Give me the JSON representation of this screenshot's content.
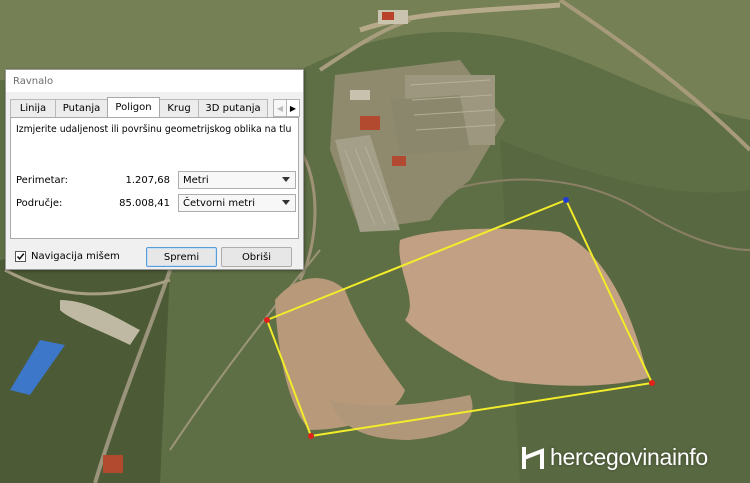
{
  "dialog": {
    "title": "Ravnalo",
    "tabs": [
      {
        "label": "Linija"
      },
      {
        "label": "Putanja"
      },
      {
        "label": "Poligon",
        "active": true
      },
      {
        "label": "Krug"
      },
      {
        "label": "3D putanja"
      }
    ],
    "description": "Izmjerite udaljenost ili površinu geometrijskog oblika na tlu",
    "perimeter": {
      "label": "Perimetar:",
      "value": "1.207,68",
      "unit": "Metri"
    },
    "area": {
      "label": "Područje:",
      "value": "85.008,41",
      "unit": "Četvorni metri"
    },
    "mouse_navigation": {
      "label": "Navigacija mišem",
      "checked": true
    },
    "save_button": "Spremi",
    "clear_button": "Obriši"
  },
  "watermark": {
    "text": "hercegovinainfo"
  },
  "colors": {
    "polygon_line": "#f2ec2a",
    "vertex": "#e0201b",
    "last_vertex": "#1f3dd6",
    "accent": "#5b9bd5"
  }
}
